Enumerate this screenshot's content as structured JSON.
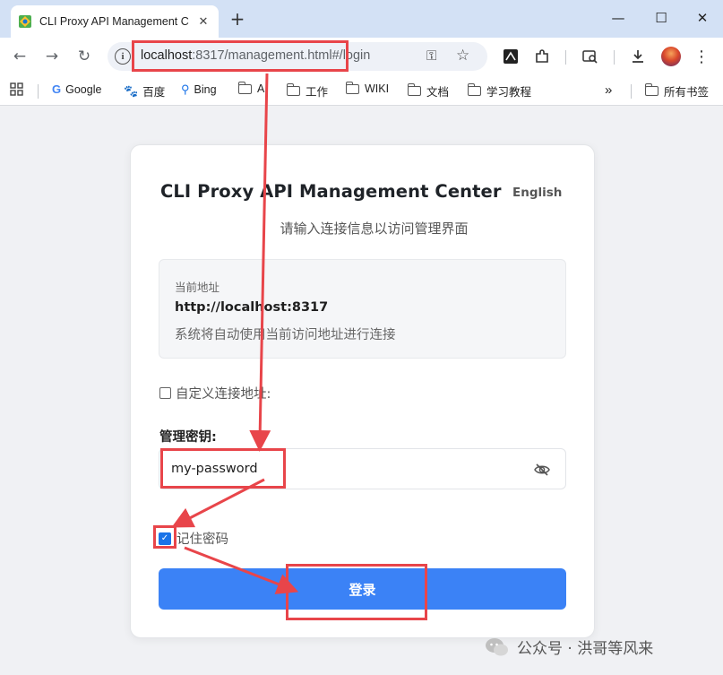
{
  "browser": {
    "tab": {
      "title": "CLI Proxy API Management C",
      "close": "✕"
    },
    "new_tab": "+",
    "window": {
      "minimize": "—",
      "maximize": "☐",
      "close": "✕"
    },
    "nav": {
      "back": "←",
      "forward": "→",
      "reload": "↻"
    },
    "address": {
      "host": "localhost",
      "rest": ":8317/management.html#/login"
    },
    "bookmarks": [
      {
        "label": "Google"
      },
      {
        "label": "百度"
      },
      {
        "label": "Bing"
      },
      {
        "label": "AI"
      },
      {
        "label": "工作"
      },
      {
        "label": "WIKI"
      },
      {
        "label": "文档"
      },
      {
        "label": "学习教程"
      }
    ],
    "bookmarks_more": "»",
    "all_bookmarks": "所有书签"
  },
  "page": {
    "title": "CLI Proxy API Management Center",
    "language": "English",
    "subtitle": "请输入连接信息以访问管理界面",
    "current_address_label": "当前地址",
    "current_address": "http://localhost:8317",
    "auto_connect_hint": "系统将自动使用当前访问地址进行连接",
    "custom_address_label": "自定义连接地址:",
    "custom_address_checked": false,
    "management_key_label": "管理密钥:",
    "management_key_value": "my-password",
    "remember_password_label": "记住密码",
    "remember_password_checked": true,
    "login_button": "登录"
  },
  "watermark": "公众号 · 洪哥等风来",
  "colors": {
    "primary_button": "#3b82f6",
    "annotation_red": "#e8454a",
    "checkbox_blue": "#1a73e8"
  }
}
